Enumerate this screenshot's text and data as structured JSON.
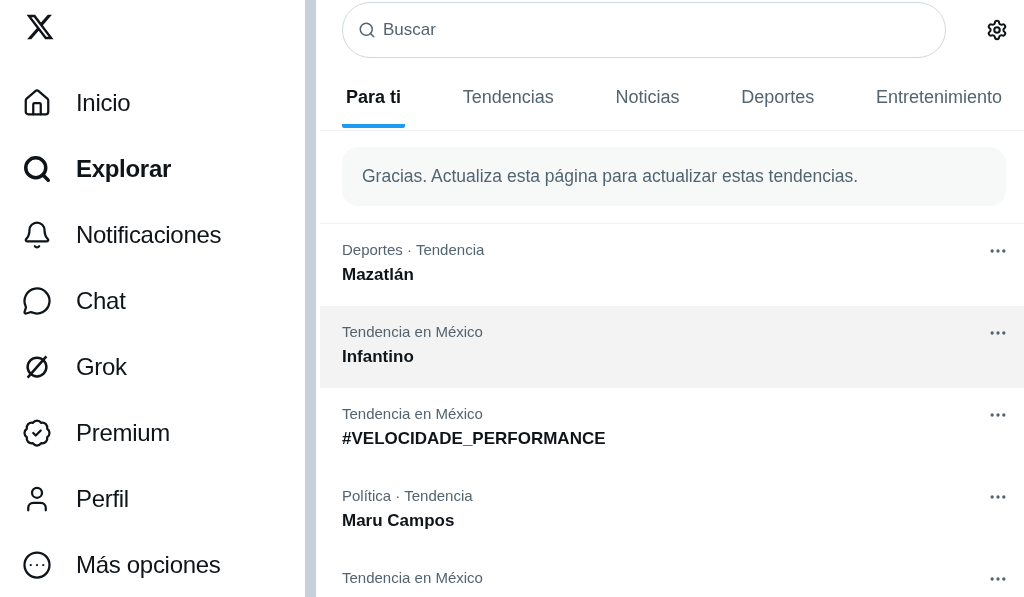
{
  "sidebar": {
    "items": [
      {
        "label": "Inicio",
        "selected": false
      },
      {
        "label": "Explorar",
        "selected": true
      },
      {
        "label": "Notificaciones",
        "selected": false
      },
      {
        "label": "Chat",
        "selected": false
      },
      {
        "label": "Grok",
        "selected": false
      },
      {
        "label": "Premium",
        "selected": false
      },
      {
        "label": "Perfil",
        "selected": false
      },
      {
        "label": "Más opciones",
        "selected": false
      }
    ]
  },
  "search": {
    "placeholder": "Buscar"
  },
  "tabs": [
    {
      "label": "Para ti",
      "selected": true
    },
    {
      "label": "Tendencias",
      "selected": false
    },
    {
      "label": "Noticias",
      "selected": false
    },
    {
      "label": "Deportes",
      "selected": false
    },
    {
      "label": "Entretenimiento",
      "selected": false
    }
  ],
  "notice": "Gracias. Actualiza esta página para actualizar estas tendencias.",
  "trends": [
    {
      "meta": "Deportes · Tendencia",
      "title": "Mazatlán",
      "hovered": false
    },
    {
      "meta": "Tendencia en México",
      "title": "Infantino",
      "hovered": true
    },
    {
      "meta": "Tendencia en México",
      "title": "#VELOCIDADE_PERFORMANCE",
      "hovered": false
    },
    {
      "meta": "Política · Tendencia",
      "title": "Maru Campos",
      "hovered": false
    },
    {
      "meta": "Tendencia en México",
      "hovered": false
    }
  ]
}
